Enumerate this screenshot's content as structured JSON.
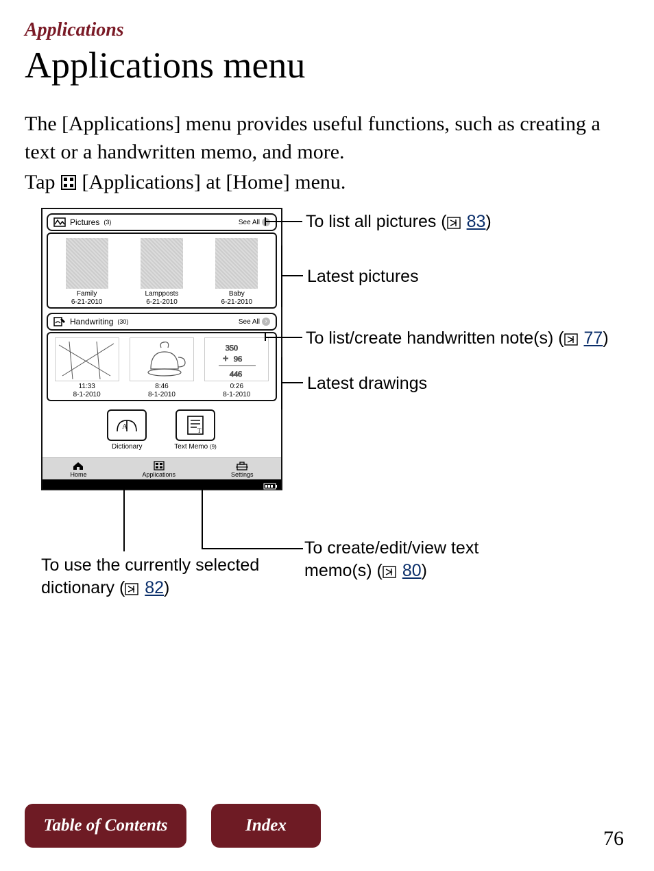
{
  "section_header": "Applications",
  "title": "Applications menu",
  "intro": "The [Applications] menu provides useful functions, such as creating a text or a handwritten memo, and more.",
  "tap_line_pre": "Tap ",
  "tap_line_post": " [Applications] at [Home] menu.",
  "screenshot": {
    "pictures": {
      "label": "Pictures",
      "count": "(3)",
      "see_all": "See All",
      "items": [
        {
          "label": "Family",
          "date": "6-21-2010"
        },
        {
          "label": "Lampposts",
          "date": "6-21-2010"
        },
        {
          "label": "Baby",
          "date": "6-21-2010"
        }
      ]
    },
    "handwriting": {
      "label": "Handwriting",
      "count": "(30)",
      "see_all": "See All",
      "items": [
        {
          "label": "11:33",
          "date": "8-1-2010"
        },
        {
          "label": "8:46",
          "date": "8-1-2010"
        },
        {
          "label": "0:26",
          "date": "8-1-2010"
        }
      ]
    },
    "tiles": {
      "dictionary": "Dictionary",
      "text_memo": "Text Memo",
      "text_memo_count": "(9)"
    },
    "footer": {
      "home": "Home",
      "applications": "Applications",
      "settings": "Settings"
    }
  },
  "callouts": {
    "pictures_all_pre": "To list all pictures (",
    "pictures_all_page": "83",
    "pictures_all_post": ")",
    "latest_pictures": "Latest pictures",
    "handwriting_all_pre": "To list/create handwritten note(s) (",
    "handwriting_all_page": "77",
    "handwriting_all_post": ")",
    "latest_drawings": "Latest drawings",
    "dictionary_pre": "To use the currently selected dictionary (",
    "dictionary_page": "82",
    "dictionary_post": ")",
    "textmemo_pre": "To create/edit/view text memo(s) (",
    "textmemo_page": "80",
    "textmemo_post": ")"
  },
  "footer": {
    "toc": "Table of Contents",
    "index": "Index"
  },
  "page_number": "76"
}
